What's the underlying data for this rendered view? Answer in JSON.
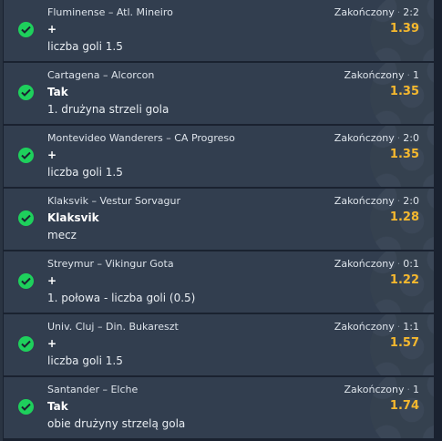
{
  "colors": {
    "accent_success": "#1ed05c",
    "odds": "#f5b82e",
    "card_bg": "#323e4f",
    "page_bg": "#1a2230"
  },
  "bets": [
    {
      "match": "Fluminense – Atl. Mineiro",
      "pick": "+",
      "market": "liczba goli 1.5",
      "status": "Zakończony",
      "score": "2:2",
      "odds": "1.39",
      "icon": "check-circle-icon"
    },
    {
      "match": "Cartagena – Alcorcon",
      "pick": "Tak",
      "market": "1. drużyna strzeli gola",
      "status": "Zakończony",
      "score": "1",
      "odds": "1.35",
      "icon": "check-circle-icon"
    },
    {
      "match": "Montevideo Wanderers – CA Progreso",
      "pick": "+",
      "market": "liczba goli 1.5",
      "status": "Zakończony",
      "score": "2:0",
      "odds": "1.35",
      "icon": "check-circle-icon"
    },
    {
      "match": "Klaksvik – Vestur Sorvagur",
      "pick": "Klaksvik",
      "market": "mecz",
      "status": "Zakończony",
      "score": "2:0",
      "odds": "1.28",
      "icon": "check-circle-icon"
    },
    {
      "match": "Streymur – Vikingur Gota",
      "pick": "+",
      "market": "1. połowa - liczba goli (0.5)",
      "status": "Zakończony",
      "score": "0:1",
      "odds": "1.22",
      "icon": "check-circle-icon"
    },
    {
      "match": "Univ. Cluj – Din. Bukareszt",
      "pick": "+",
      "market": "liczba goli 1.5",
      "status": "Zakończony",
      "score": "1:1",
      "odds": "1.57",
      "icon": "check-circle-icon"
    },
    {
      "match": "Santander – Elche",
      "pick": "Tak",
      "market": "obie drużyny strzelą gola",
      "status": "Zakończony",
      "score": "1",
      "odds": "1.74",
      "icon": "check-circle-icon"
    }
  ]
}
